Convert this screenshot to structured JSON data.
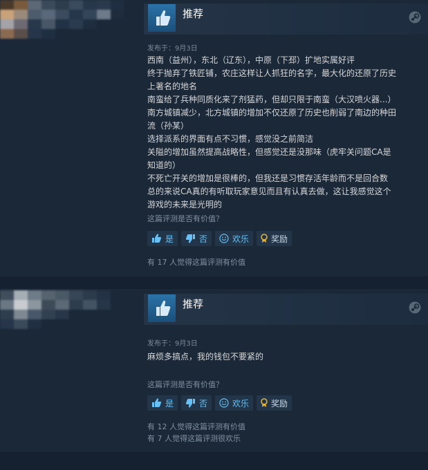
{
  "reviews": [
    {
      "verdict": "推荐",
      "posted": "发布于：9月3日",
      "lines": [
        "西南（益州），东北（辽东），中原（下邳）扩地实属好评",
        "终于抛弃了铁匠铺，农庄这样让人抓狂的名字，最大化的还原了历史",
        "上著名的地名",
        "南蛮给了兵种同质化来了剂猛药，但却只限于南蛮（大汉喷火器...）",
        "南方城镇减少，北方城镇的增加不仅还原了历史也削弱了南边的种田",
        "流（孙某）",
        "选择派系的界面有点不习惯，感觉没之前简洁",
        "关隘的增加虽然提高战略性，但感觉还是没那味（虎牢关问题CA是",
        "知道的）",
        "不死亡开关的增加是很棒的，但我还是习惯存活年龄而不是回合数",
        "总的来说CA真的有听取玩家意见而且有认真去做，这让我感觉这个",
        "游戏的未来是光明的"
      ],
      "helpful_question": "这篇评测是否有价值？",
      "buttons": {
        "yes": "是",
        "no": "否",
        "funny": "欢乐",
        "award": "奖励"
      },
      "stats": [
        "有 17 人觉得这篇评测有价值"
      ]
    },
    {
      "verdict": "推荐",
      "posted": "发布于：9月3日",
      "lines": [
        "麻烦多搞点，我的钱包不要紧的"
      ],
      "helpful_question": "这篇评测是否有价值？",
      "buttons": {
        "yes": "是",
        "no": "否",
        "funny": "欢乐",
        "award": "奖励"
      },
      "stats": [
        "有 12 人觉得这篇评测有价值",
        "有 7 人觉得这篇评测很欢乐"
      ]
    }
  ],
  "colors": {
    "background": "#1b2838",
    "button_text": "#67c1f5",
    "thumb_box": "#2b73a8"
  }
}
